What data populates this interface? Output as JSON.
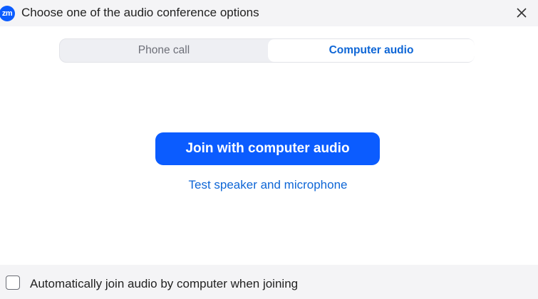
{
  "window": {
    "app_logo_text": "zm",
    "title": "Choose one of the audio conference options",
    "close_icon": "close-icon"
  },
  "tabs": [
    {
      "label": "Phone call",
      "selected": false
    },
    {
      "label": "Computer audio",
      "selected": true
    }
  ],
  "main": {
    "join_button_label": "Join with computer audio",
    "test_link_label": "Test speaker and microphone"
  },
  "footer": {
    "auto_join_label": "Automatically join audio by computer when joining",
    "auto_join_checked": false
  },
  "colors": {
    "accent": "#0b5cff",
    "link": "#0e66d6",
    "chrome_bg": "#f4f4f6"
  }
}
